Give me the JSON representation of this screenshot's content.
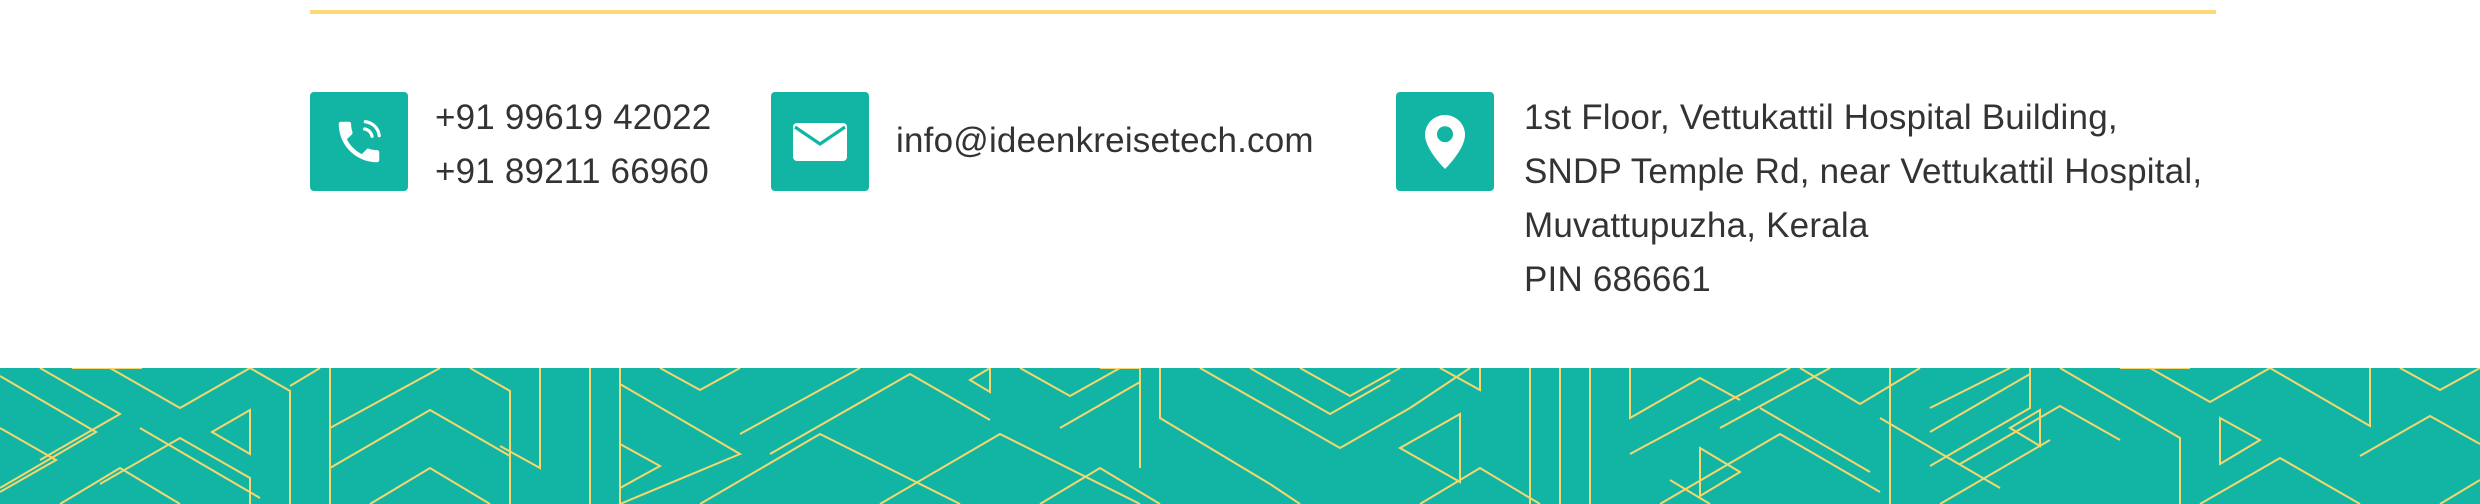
{
  "colors": {
    "accent_teal": "#12b5a4",
    "rule_yellow": "#fdd978",
    "pattern_line": "#f5d76e",
    "text": "#333333"
  },
  "contact": {
    "phone": {
      "icon": "phone-icon",
      "numbers": [
        "+91 99619 42022",
        "+91 89211 66960"
      ]
    },
    "email": {
      "icon": "envelope-icon",
      "address": "info@ideenkreisetech.com"
    },
    "location": {
      "icon": "map-pin-icon",
      "lines": [
        "1st Floor, Vettukattil Hospital Building,",
        "SNDP Temple Rd, near Vettukattil Hospital,",
        "Muvattupuzha, Kerala",
        "PIN 686661"
      ]
    }
  }
}
